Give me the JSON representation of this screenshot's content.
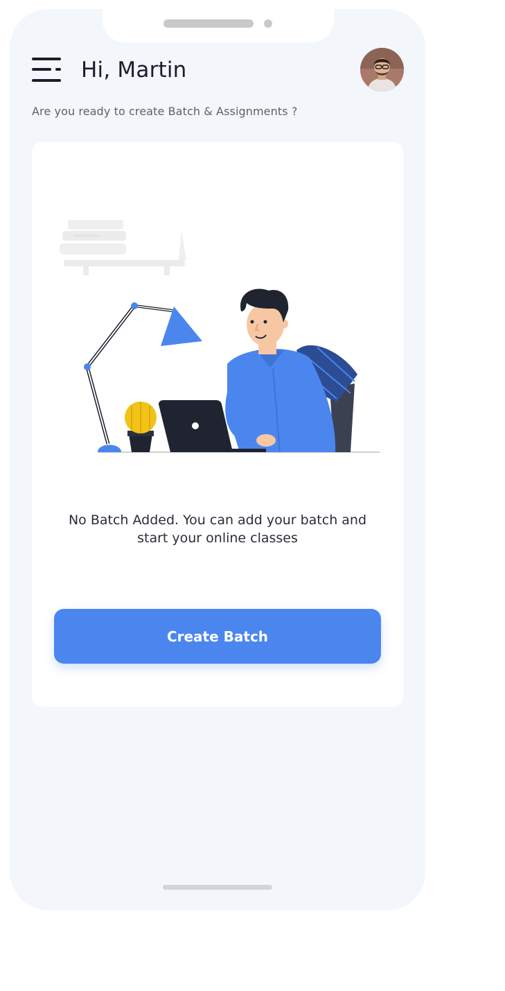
{
  "header": {
    "greeting": "Hi, Martin",
    "subtitle": "Are you ready to create Batch & Assignments ?",
    "menu_icon": "menu-icon",
    "avatar_icon": "user-avatar"
  },
  "empty_state": {
    "message": "No Batch Added. You can add your batch and start your online classes",
    "illustration": "person-working-at-laptop-illustration",
    "button_label": "Create Batch"
  },
  "colors": {
    "accent": "#4a86ee",
    "background": "#f3f7fb",
    "card": "#ffffff",
    "text_dark": "#1b1d2b"
  }
}
